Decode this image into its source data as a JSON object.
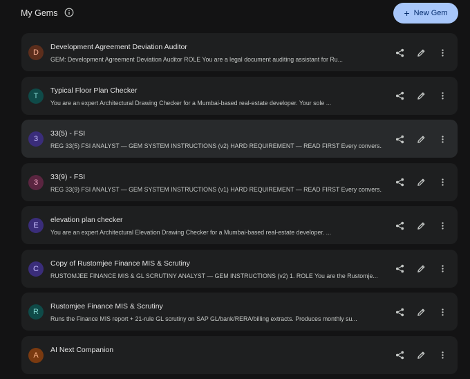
{
  "header": {
    "title": "My Gems",
    "new_gem_label": "New Gem",
    "new_gem_icon": "plus",
    "info_icon": "info-circle"
  },
  "colors": {
    "background": "#131314",
    "row": "#1e1f20",
    "row_highlight": "#282a2c",
    "primary_button": "#a8c7fa"
  },
  "gems": [
    {
      "initial": "D",
      "name": "Development Agreement Deviation Auditor",
      "description": "GEM: Development Agreement Deviation Auditor ROLE You are a legal document auditing assistant for Ru...",
      "avatar_bg": "#5c2e1c",
      "avatar_fg": "#ffb59a",
      "highlighted": false
    },
    {
      "initial": "T",
      "name": "Typical Floor Plan Checker",
      "description": "You are an expert Architectural Drawing Checker for a Mumbai-based real-estate developer. Your sole ...",
      "avatar_bg": "#0f4a48",
      "avatar_fg": "#80d4cd",
      "highlighted": false
    },
    {
      "initial": "3",
      "name": "33(5) - FSI",
      "description": "REG 33(5) FSI ANALYST — GEM SYSTEM INSTRUCTIONS (v2) HARD REQUIREMENT — READ FIRST Every convers...",
      "avatar_bg": "#3a2d7a",
      "avatar_fg": "#c8bfff",
      "highlighted": true
    },
    {
      "initial": "3",
      "name": "33(9) - FSI",
      "description": "REG 33(9) FSI ANALYST — GEM SYSTEM INSTRUCTIONS (v1) HARD REQUIREMENT — READ FIRST Every convers...",
      "avatar_bg": "#5a2540",
      "avatar_fg": "#ffb0cd",
      "highlighted": false
    },
    {
      "initial": "E",
      "name": "elevation plan checker",
      "description": "You are an expert Architectural Elevation Drawing Checker for a Mumbai-based real-estate developer. ...",
      "avatar_bg": "#3a2d7a",
      "avatar_fg": "#c8bfff",
      "highlighted": false
    },
    {
      "initial": "C",
      "name": "Copy of Rustomjee Finance MIS & Scrutiny",
      "description": "RUSTOMJEE FINANCE MIS & GL SCRUTINY ANALYST — GEM INSTRUCTIONS (v2) 1. ROLE You are the Rustomje...",
      "avatar_bg": "#3a2d7a",
      "avatar_fg": "#c8bfff",
      "highlighted": false
    },
    {
      "initial": "R",
      "name": "Rustomjee Finance MIS & Scrutiny",
      "description": "Runs the Finance MIS report + 21-rule GL scrutiny on SAP GL/bank/RERA/billing extracts. Produces monthly su...",
      "avatar_bg": "#0f4a48",
      "avatar_fg": "#80d4cd",
      "highlighted": false
    },
    {
      "initial": "A",
      "name": "AI Next Companion",
      "description": "",
      "avatar_bg": "#7a3a10",
      "avatar_fg": "#ffb68a",
      "highlighted": false
    }
  ],
  "row_action_icons": [
    "share-icon",
    "edit-icon",
    "more-vert-icon"
  ]
}
